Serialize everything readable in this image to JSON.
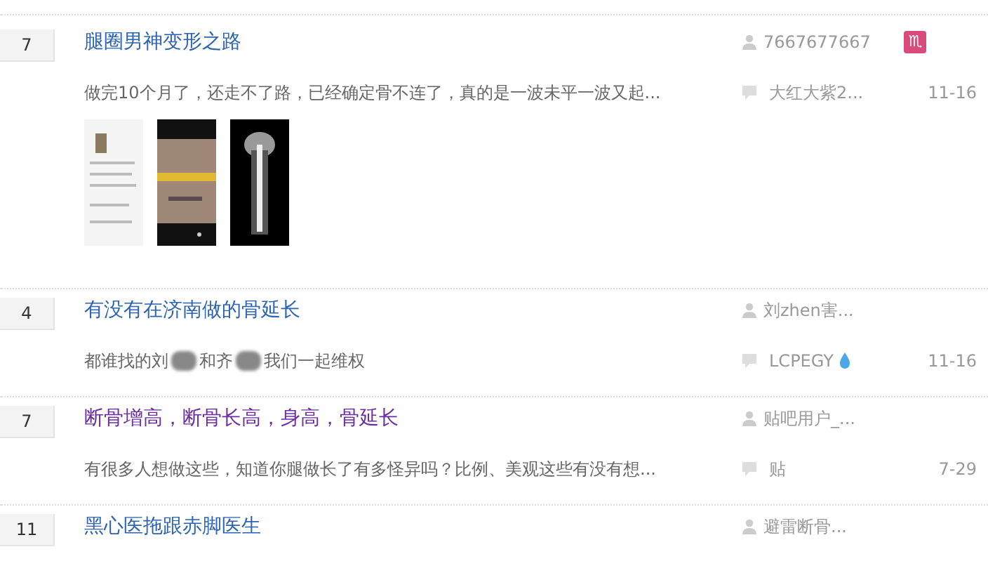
{
  "threads": [
    {
      "replies": "7",
      "title": "腿圈男神变形之路",
      "visited": false,
      "author": "7667677667",
      "badge": "♏",
      "excerpt": [
        {
          "kind": "text",
          "text": "做完10个月了，还走不了路，已经确定骨不连了，真的是一波未平一波又起..."
        }
      ],
      "last_reply_by": "大红大紫2...",
      "date": "11-16"
    },
    {
      "replies": "4",
      "title": "有没有在济南做的骨延长",
      "visited": false,
      "author": "刘zhen害...",
      "excerpt": [
        {
          "kind": "text",
          "text": "都谁找的刘"
        },
        {
          "kind": "redacted"
        },
        {
          "kind": "text",
          "text": "和齐"
        },
        {
          "kind": "redacted"
        },
        {
          "kind": "text",
          "text": "我们一起维权"
        }
      ],
      "last_reply_by": "LCPEGY",
      "last_reply_badge": true,
      "date": "11-16"
    },
    {
      "replies": "7",
      "title": "断骨增高，断骨长高，身高，骨延长",
      "visited": true,
      "author": "贴吧用户_...",
      "excerpt": [
        {
          "kind": "text",
          "text": "有很多人想做这些，知道你腿做长了有多怪异吗？比例、美观这些有没有想..."
        }
      ],
      "last_reply_by": "贴",
      "date": "7-29"
    },
    {
      "replies": "11",
      "title": "黑心医拖跟赤脚医生",
      "visited": false,
      "author": "避雷断骨..."
    }
  ]
}
